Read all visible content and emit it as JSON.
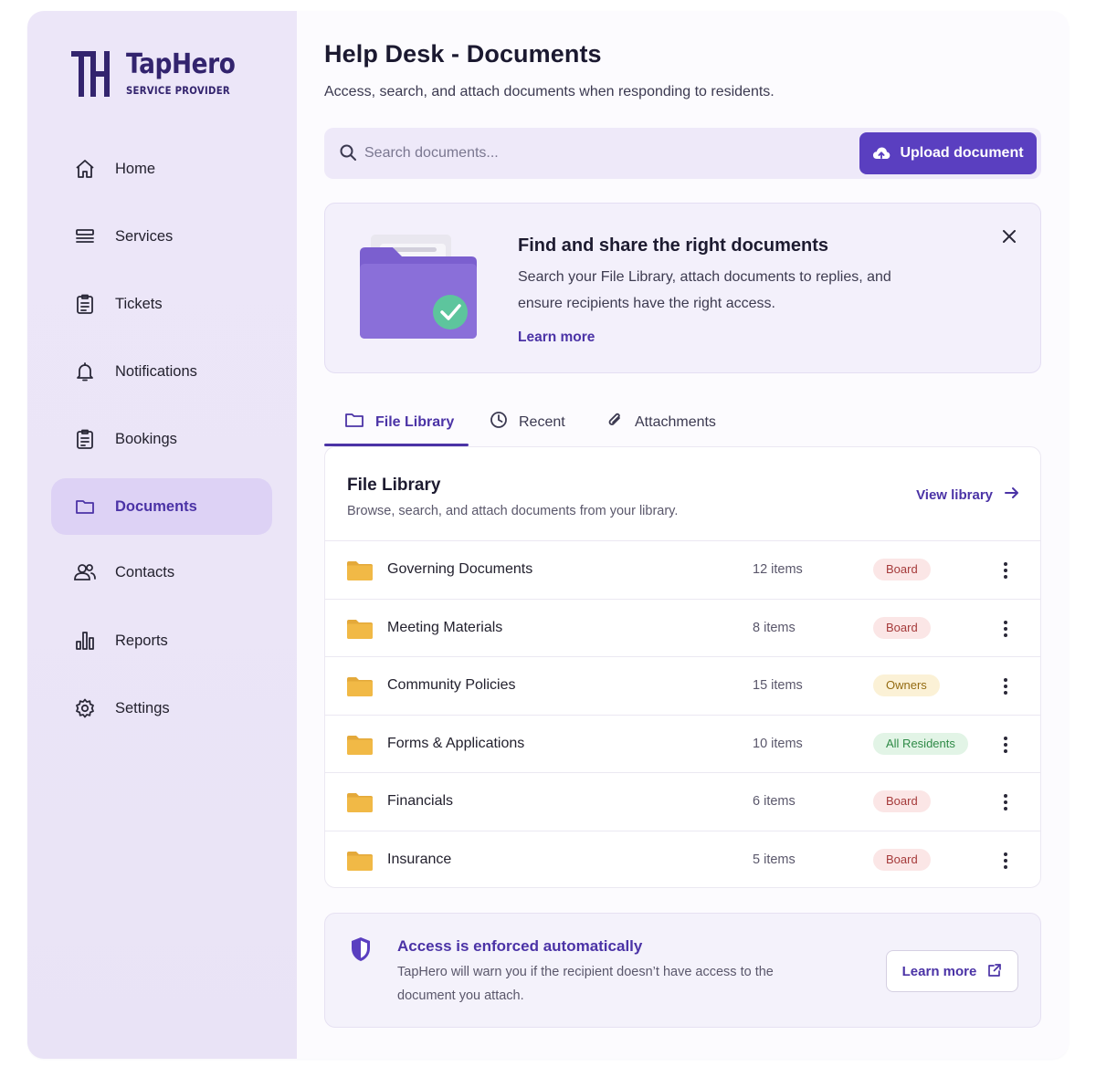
{
  "app": {
    "brand_name": "TapHero",
    "brand_sub": "SERVICE PROVIDER",
    "accent": "#5a3fc0"
  },
  "sidebar": {
    "items": [
      {
        "label": "Home",
        "icon": "home-icon"
      },
      {
        "label": "Services",
        "icon": "services-icon"
      },
      {
        "label": "Tickets",
        "icon": "ticket-icon"
      },
      {
        "label": "Notifications",
        "icon": "bell-icon"
      },
      {
        "label": "Bookings",
        "icon": "clipboard-icon"
      },
      {
        "label": "Documents",
        "icon": "folder-icon",
        "active": true
      },
      {
        "label": "Contacts",
        "icon": "contacts-icon"
      },
      {
        "label": "Reports",
        "icon": "bar-chart-icon"
      },
      {
        "label": "Settings",
        "icon": "gear-icon"
      }
    ]
  },
  "header": {
    "title": "Help Desk - Documents",
    "subtitle": "Access, search, and attach documents when responding to residents."
  },
  "search": {
    "placeholder": "Search documents...",
    "value": ""
  },
  "upload": {
    "label": "Upload document"
  },
  "banner": {
    "title": "Find and share the right documents",
    "text": "Search your File Library, attach documents to replies, and ensure recipients have the right access.",
    "link": "Learn more"
  },
  "tabs": [
    {
      "label": "File Library",
      "icon": "folder-icon",
      "active": true
    },
    {
      "label": "Recent",
      "icon": "clock-icon"
    },
    {
      "label": "Attachments",
      "icon": "paperclip-icon"
    }
  ],
  "library": {
    "title": "File Library",
    "subtitle": "Browse, search, and attach documents from your library.",
    "view_link": "View library",
    "rows": [
      {
        "name": "Governing Documents",
        "count": "12 items",
        "access": "Board",
        "access_type": "board"
      },
      {
        "name": "Meeting Materials",
        "count": "8 items",
        "access": "Board",
        "access_type": "board"
      },
      {
        "name": "Community Policies",
        "count": "15 items",
        "access": "Owners",
        "access_type": "owners"
      },
      {
        "name": "Forms & Applications",
        "count": "10 items",
        "access": "All Residents",
        "access_type": "all"
      },
      {
        "name": "Financials",
        "count": "6 items",
        "access": "Board",
        "access_type": "board"
      },
      {
        "name": "Insurance",
        "count": "5 items",
        "access": "Board",
        "access_type": "board"
      }
    ]
  },
  "access_notice": {
    "title": "Access is enforced automatically",
    "text": "TapHero will warn you if the recipient doesn’t have access to the document you attach.",
    "button": "Learn more"
  }
}
